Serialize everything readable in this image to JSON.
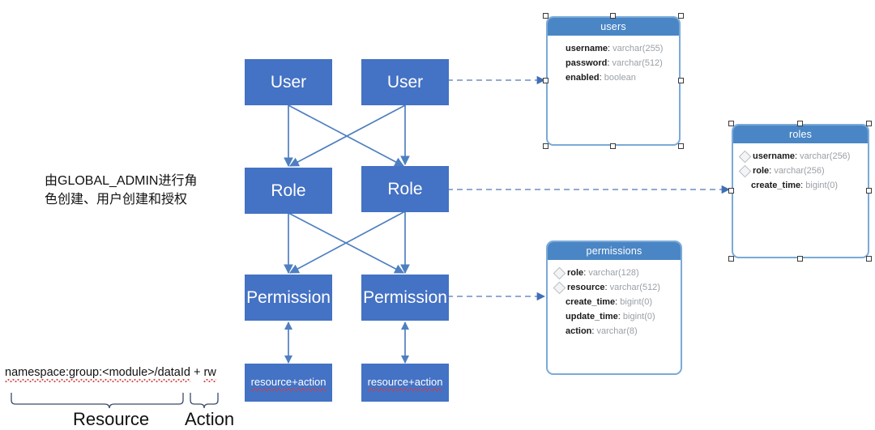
{
  "diagram": {
    "type": "permission-model-er-diagram",
    "background": "#ffffff",
    "accent_box": "#4472C4",
    "accent_table_header": "#4a86c5",
    "accent_table_border": "#7aaad8",
    "edge_color": "#4f7fc0",
    "spellcheck_underline": "#d84a4a"
  },
  "flow_nodes": {
    "user_left": "User",
    "user_right": "User",
    "role_left": "Role",
    "role_right": "Role",
    "permission_left": "Permission",
    "permission_right": "Permission",
    "resource_action_left": "resource+action",
    "resource_action_right": "resource+action"
  },
  "annotations": {
    "chinese_note_line1": "由GLOBAL_ADMIN进行角",
    "chinese_note_line2": "色创建、用户创建和授权",
    "expression_prefix": "namespace:group:<module>/dataId",
    "expression_plus": " + ",
    "expression_suffix": "rw",
    "brace_resource_label": "Resource",
    "brace_action_label": "Action"
  },
  "tables": [
    {
      "name": "users",
      "selected": true,
      "fields": [
        {
          "key": false,
          "name": "username",
          "type": "varchar(255)"
        },
        {
          "key": false,
          "name": "password",
          "type": "varchar(512)"
        },
        {
          "key": false,
          "name": "enabled",
          "type": "boolean"
        }
      ]
    },
    {
      "name": "roles",
      "selected": true,
      "fields": [
        {
          "key": true,
          "name": "username",
          "type": "varchar(256)"
        },
        {
          "key": true,
          "name": "role",
          "type": "varchar(256)"
        },
        {
          "key": false,
          "name": "create_time",
          "type": "bigint(0)"
        }
      ]
    },
    {
      "name": "permissions",
      "selected": false,
      "fields": [
        {
          "key": true,
          "name": "role",
          "type": "varchar(128)"
        },
        {
          "key": true,
          "name": "resource",
          "type": "varchar(512)"
        },
        {
          "key": false,
          "name": "create_time",
          "type": "bigint(0)"
        },
        {
          "key": false,
          "name": "update_time",
          "type": "bigint(0)"
        },
        {
          "key": false,
          "name": "action",
          "type": "varchar(8)"
        }
      ]
    }
  ],
  "edges": {
    "solid_label": "inheritance-and-assignment-links",
    "dashed_label": "maps-to-table-links",
    "double_label": "bidirectional-composition-links"
  }
}
